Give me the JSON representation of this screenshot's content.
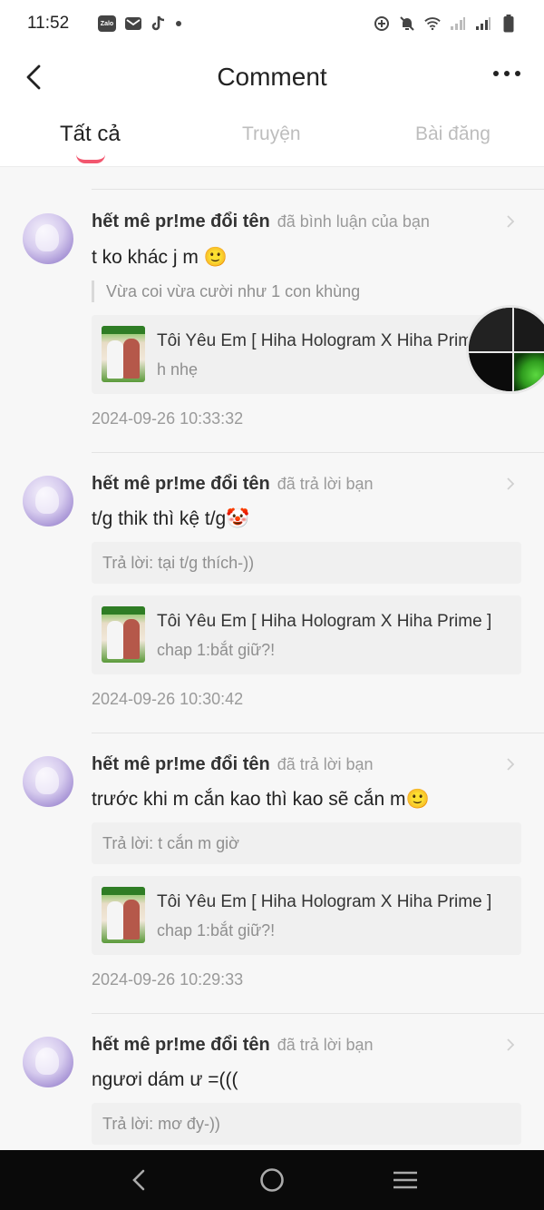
{
  "status_bar": {
    "time": "11:52",
    "left_icons": [
      "zalo-icon",
      "gmail-icon",
      "tiktok-icon",
      "dot-icon"
    ],
    "zalo_text": "Zalo",
    "right_icons": [
      "data-saver-icon",
      "mute-bell-icon",
      "wifi-icon",
      "signal-icon",
      "signal-icon",
      "battery-icon"
    ]
  },
  "header": {
    "title": "Comment"
  },
  "tabs": [
    {
      "label": "Tất cả",
      "active": true
    },
    {
      "label": "Truyện",
      "active": false
    },
    {
      "label": "Bài đăng",
      "active": false
    }
  ],
  "items": [
    {
      "username": "hết mê pr!me đổi tên",
      "action": "đã bình luận của bạn",
      "comment": "t ko khác j m 🙂",
      "quote": "Vừa coi vừa cười như 1 con khùng",
      "reply": null,
      "story_title": "Tôi Yêu Em [ Hiha Hologram X Hiha Prime ]",
      "story_sub": "h nhẹ",
      "date": "2024-09-26 10:33:32"
    },
    {
      "username": "hết mê pr!me đổi tên",
      "action": "đã trả lời bạn",
      "comment": "t/g thik thì kệ t/g🤡",
      "quote": null,
      "reply": "Trả lời: tại t/g thích-))",
      "story_title": "Tôi Yêu Em [ Hiha Hologram X Hiha Prime ]",
      "story_sub": "chap 1:bắt giữ?!",
      "date": "2024-09-26 10:30:42"
    },
    {
      "username": "hết mê pr!me đổi tên",
      "action": "đã trả lời bạn",
      "comment": "trước khi m cắn kao thì kao sẽ cắn m🙂",
      "quote": null,
      "reply": "Trả lời: t cắn m giờ",
      "story_title": "Tôi Yêu Em [ Hiha Hologram X Hiha Prime ]",
      "story_sub": "chap 1:bắt giữ?!",
      "date": "2024-09-26 10:29:33"
    },
    {
      "username": "hết mê pr!me đổi tên",
      "action": "đã trả lời bạn",
      "comment": "ngươi dám ư =(((",
      "quote": null,
      "reply": "Trả lời: mơ đy-))",
      "story_title": null,
      "story_sub": null,
      "date": null
    }
  ],
  "colors": {
    "accent": "#f2566e",
    "background": "#f7f7f7",
    "card": "#f0f0f0",
    "muted_text": "#9a9a9a"
  },
  "nav_bar": {
    "icons": [
      "nav-back-icon",
      "nav-home-icon",
      "nav-recents-icon"
    ]
  }
}
